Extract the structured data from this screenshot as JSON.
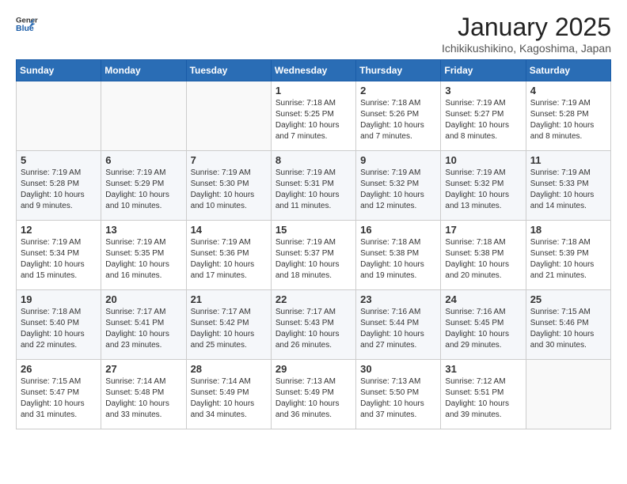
{
  "header": {
    "logo_general": "General",
    "logo_blue": "Blue",
    "month_title": "January 2025",
    "location": "Ichikikushikino, Kagoshima, Japan"
  },
  "weekdays": [
    "Sunday",
    "Monday",
    "Tuesday",
    "Wednesday",
    "Thursday",
    "Friday",
    "Saturday"
  ],
  "weeks": [
    [
      {
        "day": "",
        "info": ""
      },
      {
        "day": "",
        "info": ""
      },
      {
        "day": "",
        "info": ""
      },
      {
        "day": "1",
        "info": "Sunrise: 7:18 AM\nSunset: 5:25 PM\nDaylight: 10 hours\nand 7 minutes."
      },
      {
        "day": "2",
        "info": "Sunrise: 7:18 AM\nSunset: 5:26 PM\nDaylight: 10 hours\nand 7 minutes."
      },
      {
        "day": "3",
        "info": "Sunrise: 7:19 AM\nSunset: 5:27 PM\nDaylight: 10 hours\nand 8 minutes."
      },
      {
        "day": "4",
        "info": "Sunrise: 7:19 AM\nSunset: 5:28 PM\nDaylight: 10 hours\nand 8 minutes."
      }
    ],
    [
      {
        "day": "5",
        "info": "Sunrise: 7:19 AM\nSunset: 5:28 PM\nDaylight: 10 hours\nand 9 minutes."
      },
      {
        "day": "6",
        "info": "Sunrise: 7:19 AM\nSunset: 5:29 PM\nDaylight: 10 hours\nand 10 minutes."
      },
      {
        "day": "7",
        "info": "Sunrise: 7:19 AM\nSunset: 5:30 PM\nDaylight: 10 hours\nand 10 minutes."
      },
      {
        "day": "8",
        "info": "Sunrise: 7:19 AM\nSunset: 5:31 PM\nDaylight: 10 hours\nand 11 minutes."
      },
      {
        "day": "9",
        "info": "Sunrise: 7:19 AM\nSunset: 5:32 PM\nDaylight: 10 hours\nand 12 minutes."
      },
      {
        "day": "10",
        "info": "Sunrise: 7:19 AM\nSunset: 5:32 PM\nDaylight: 10 hours\nand 13 minutes."
      },
      {
        "day": "11",
        "info": "Sunrise: 7:19 AM\nSunset: 5:33 PM\nDaylight: 10 hours\nand 14 minutes."
      }
    ],
    [
      {
        "day": "12",
        "info": "Sunrise: 7:19 AM\nSunset: 5:34 PM\nDaylight: 10 hours\nand 15 minutes."
      },
      {
        "day": "13",
        "info": "Sunrise: 7:19 AM\nSunset: 5:35 PM\nDaylight: 10 hours\nand 16 minutes."
      },
      {
        "day": "14",
        "info": "Sunrise: 7:19 AM\nSunset: 5:36 PM\nDaylight: 10 hours\nand 17 minutes."
      },
      {
        "day": "15",
        "info": "Sunrise: 7:19 AM\nSunset: 5:37 PM\nDaylight: 10 hours\nand 18 minutes."
      },
      {
        "day": "16",
        "info": "Sunrise: 7:18 AM\nSunset: 5:38 PM\nDaylight: 10 hours\nand 19 minutes."
      },
      {
        "day": "17",
        "info": "Sunrise: 7:18 AM\nSunset: 5:38 PM\nDaylight: 10 hours\nand 20 minutes."
      },
      {
        "day": "18",
        "info": "Sunrise: 7:18 AM\nSunset: 5:39 PM\nDaylight: 10 hours\nand 21 minutes."
      }
    ],
    [
      {
        "day": "19",
        "info": "Sunrise: 7:18 AM\nSunset: 5:40 PM\nDaylight: 10 hours\nand 22 minutes."
      },
      {
        "day": "20",
        "info": "Sunrise: 7:17 AM\nSunset: 5:41 PM\nDaylight: 10 hours\nand 23 minutes."
      },
      {
        "day": "21",
        "info": "Sunrise: 7:17 AM\nSunset: 5:42 PM\nDaylight: 10 hours\nand 25 minutes."
      },
      {
        "day": "22",
        "info": "Sunrise: 7:17 AM\nSunset: 5:43 PM\nDaylight: 10 hours\nand 26 minutes."
      },
      {
        "day": "23",
        "info": "Sunrise: 7:16 AM\nSunset: 5:44 PM\nDaylight: 10 hours\nand 27 minutes."
      },
      {
        "day": "24",
        "info": "Sunrise: 7:16 AM\nSunset: 5:45 PM\nDaylight: 10 hours\nand 29 minutes."
      },
      {
        "day": "25",
        "info": "Sunrise: 7:15 AM\nSunset: 5:46 PM\nDaylight: 10 hours\nand 30 minutes."
      }
    ],
    [
      {
        "day": "26",
        "info": "Sunrise: 7:15 AM\nSunset: 5:47 PM\nDaylight: 10 hours\nand 31 minutes."
      },
      {
        "day": "27",
        "info": "Sunrise: 7:14 AM\nSunset: 5:48 PM\nDaylight: 10 hours\nand 33 minutes."
      },
      {
        "day": "28",
        "info": "Sunrise: 7:14 AM\nSunset: 5:49 PM\nDaylight: 10 hours\nand 34 minutes."
      },
      {
        "day": "29",
        "info": "Sunrise: 7:13 AM\nSunset: 5:49 PM\nDaylight: 10 hours\nand 36 minutes."
      },
      {
        "day": "30",
        "info": "Sunrise: 7:13 AM\nSunset: 5:50 PM\nDaylight: 10 hours\nand 37 minutes."
      },
      {
        "day": "31",
        "info": "Sunrise: 7:12 AM\nSunset: 5:51 PM\nDaylight: 10 hours\nand 39 minutes."
      },
      {
        "day": "",
        "info": ""
      }
    ]
  ]
}
